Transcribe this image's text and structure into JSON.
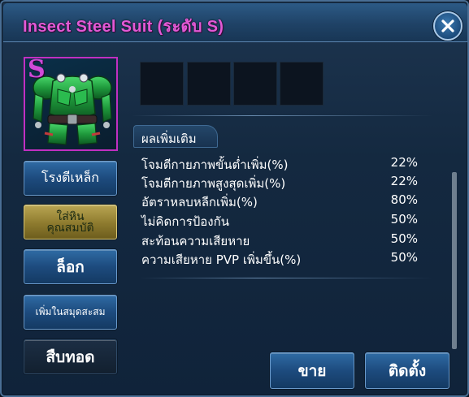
{
  "window": {
    "title": "Insect Steel Suit (ระดับ S)",
    "title_color": "#e25ad6"
  },
  "item": {
    "rank_badge": "S",
    "icon": "green-armor-suit-icon",
    "frame_color": "#c12fc2"
  },
  "sockets": [
    {
      "state": "empty"
    },
    {
      "state": "empty"
    },
    {
      "state": "empty"
    },
    {
      "state": "empty"
    }
  ],
  "bonus": {
    "section_title": "ผลเพิ่มเติม",
    "stats": [
      {
        "label": "โจมตีกายภาพขั้นต่ำเพิ่ม(%)",
        "value": "22%"
      },
      {
        "label": "โจมตีกายภาพสูงสุดเพิ่ม(%)",
        "value": "22%"
      },
      {
        "label": "อัตราหลบหลีกเพิ่ม(%)",
        "value": "80%"
      },
      {
        "label": "ไม่คิดการป้องกัน",
        "value": "50%"
      },
      {
        "label": "สะท้อนความเสียหาย",
        "value": "50%"
      },
      {
        "label": "ความเสียหาย PVP เพิ่มขึ้น(%)",
        "value": "50%"
      }
    ]
  },
  "side_buttons": {
    "smithy": "โรงตีเหล็ก",
    "socket_line1": "ใส่หิน",
    "socket_line2": "คุณสมบัติ",
    "lock": "ล็อก",
    "add_collection": "เพิ่มในสมุดสะสม",
    "inherit": "สืบทอด"
  },
  "bottom_buttons": {
    "sell": "ขาย",
    "equip": "ติดตั้ง"
  }
}
